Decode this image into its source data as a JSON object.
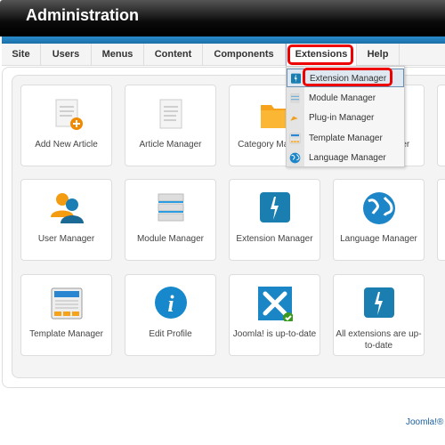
{
  "header": {
    "title": "Administration"
  },
  "nav": [
    "Site",
    "Users",
    "Menus",
    "Content",
    "Components",
    "Extensions",
    "Help"
  ],
  "dropdown": [
    {
      "label": "Extension Manager",
      "icon": "extension-icon"
    },
    {
      "label": "Module Manager",
      "icon": "module-icon"
    },
    {
      "label": "Plug-in Manager",
      "icon": "plugin-icon"
    },
    {
      "label": "Template Manager",
      "icon": "template-icon"
    },
    {
      "label": "Language Manager",
      "icon": "globe-icon"
    }
  ],
  "tiles": [
    {
      "label": "Add New Article",
      "icon": "add-article-icon"
    },
    {
      "label": "Article Manager",
      "icon": "article-icon"
    },
    {
      "label": "Category Manager",
      "icon": "folder-icon"
    },
    {
      "label": "Media Manager",
      "icon": "media-icon"
    },
    {
      "label": "User Manager",
      "icon": "users-icon"
    },
    {
      "label": "Module Manager",
      "icon": "module-icon"
    },
    {
      "label": "Extension Manager",
      "icon": "extension-icon"
    },
    {
      "label": "Language Manager",
      "icon": "globe-icon"
    },
    {
      "label": "Template Manager",
      "icon": "template-icon"
    },
    {
      "label": "Edit Profile",
      "icon": "info-icon"
    },
    {
      "label": "Joomla! is up-to-date",
      "icon": "joomla-check-icon"
    },
    {
      "label": "All extensions are up-to-date",
      "icon": "extension-icon"
    }
  ],
  "footer": "Joomla!®",
  "colors": {
    "accent": "#1a6fa8",
    "highlight": "#e00000"
  }
}
